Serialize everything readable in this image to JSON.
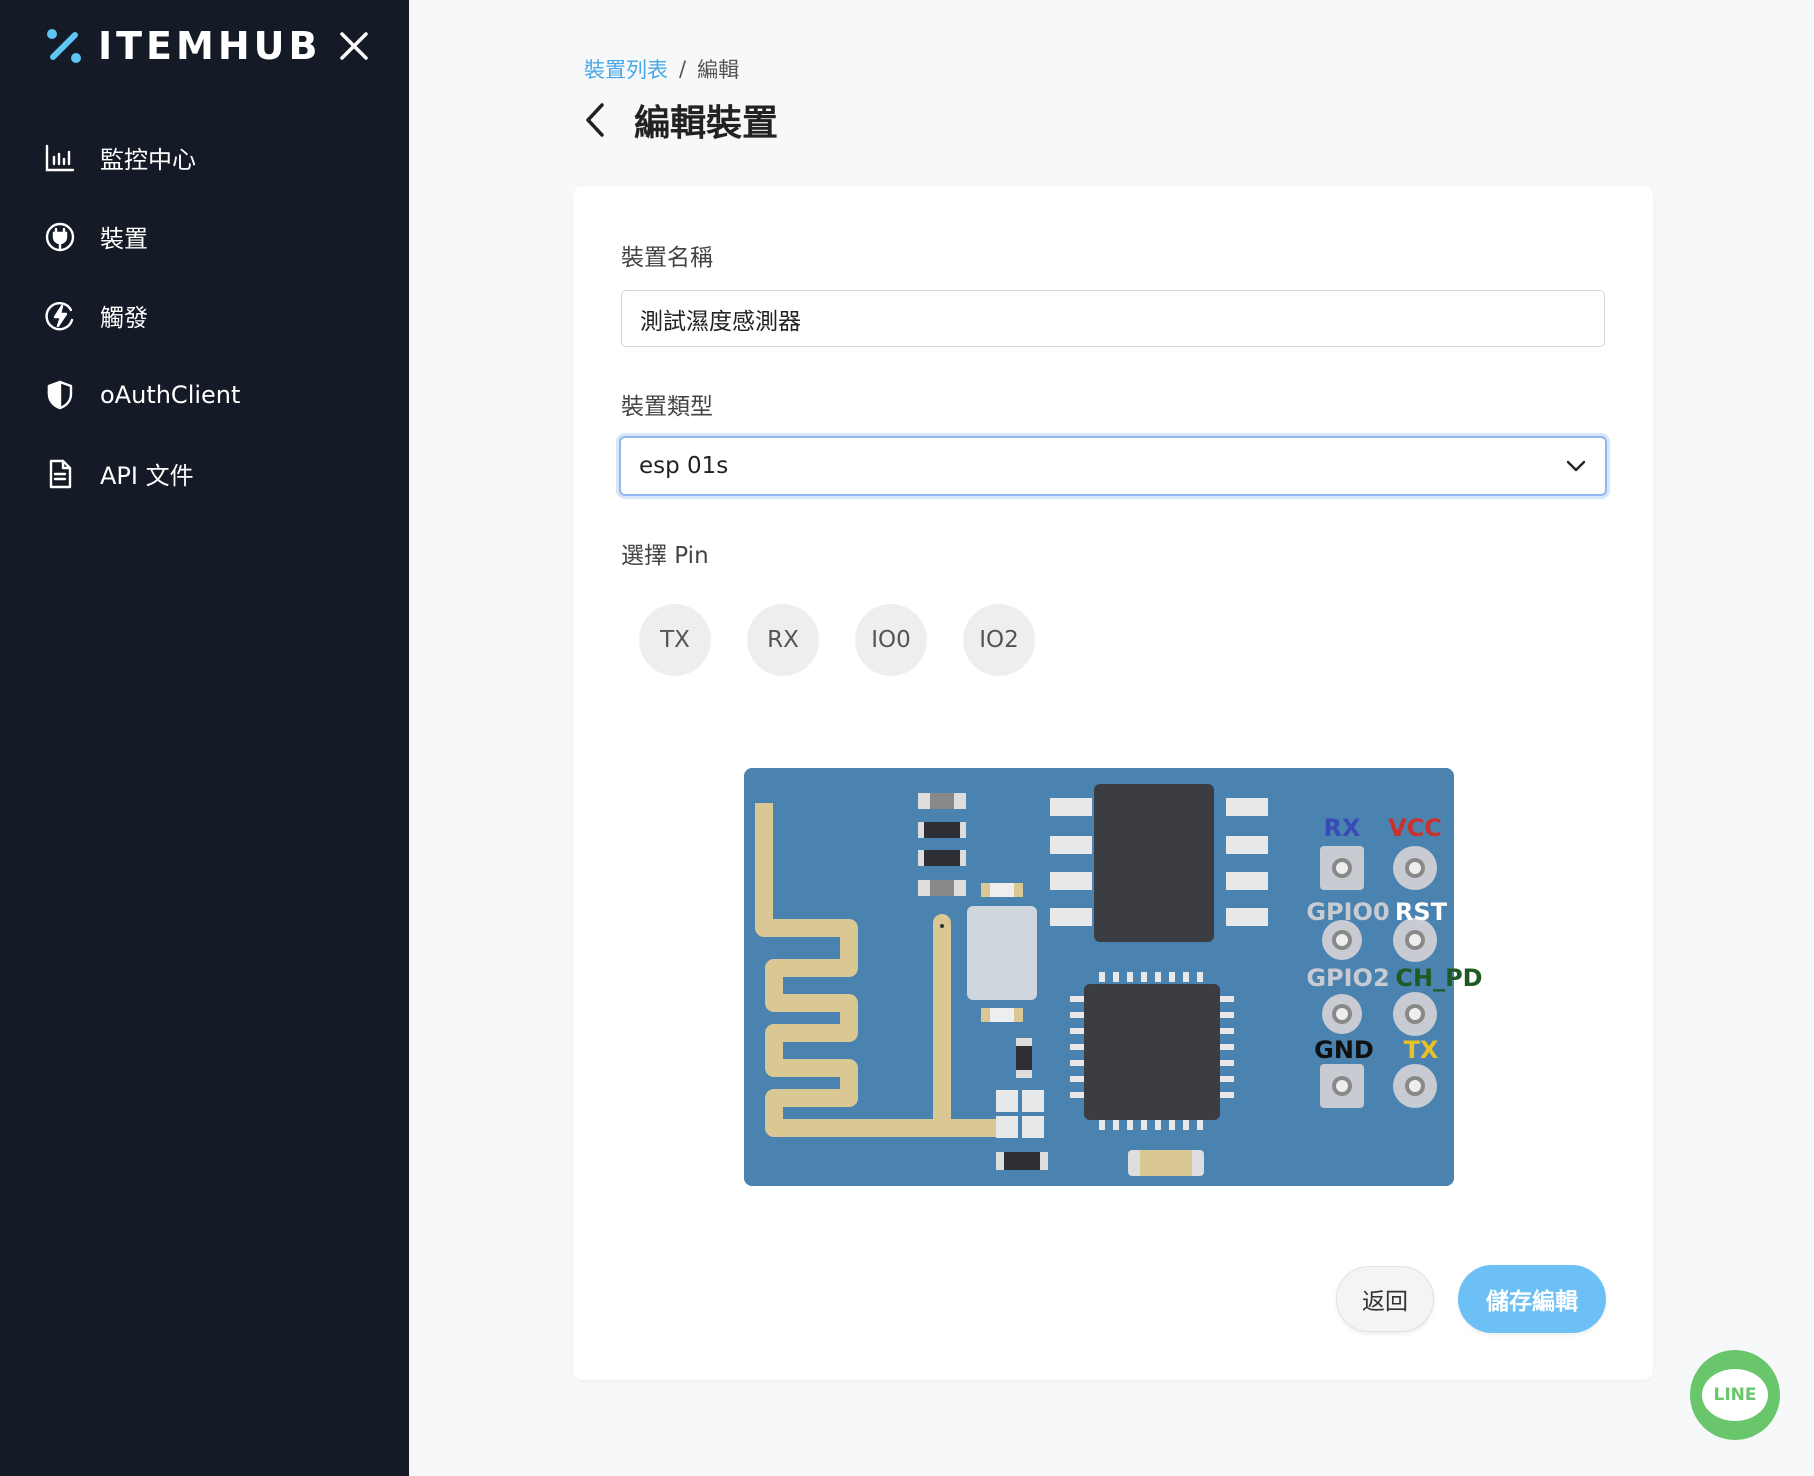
{
  "brand": {
    "name": "ITEMHUB"
  },
  "sidebar": {
    "items": [
      {
        "label": "監控中心",
        "icon": "chart-bar-icon"
      },
      {
        "label": "裝置",
        "icon": "plug-icon"
      },
      {
        "label": "觸發",
        "icon": "lightning-icon"
      },
      {
        "label": "oAuthClient",
        "icon": "shield-icon"
      },
      {
        "label": "API 文件",
        "icon": "document-icon"
      }
    ]
  },
  "breadcrumb": {
    "parent": "裝置列表",
    "separator": "/",
    "current": "編輯"
  },
  "page": {
    "title": "編輯裝置"
  },
  "form": {
    "name_label": "裝置名稱",
    "name_value": "測試濕度感測器",
    "type_label": "裝置類型",
    "type_value": "esp 01s",
    "pin_label": "選擇 Pin",
    "pins": [
      "TX",
      "RX",
      "IO0",
      "IO2"
    ]
  },
  "board": {
    "pin_labels": {
      "rx": "RX",
      "vcc": "VCC",
      "gpio0": "GPIO0",
      "rst": "RST",
      "gpio2": "GPIO2",
      "ch_pd": "CH_PD",
      "gnd": "GND",
      "tx": "TX"
    },
    "colors": {
      "pcb": "#4a82b0",
      "antenna": "#d9c894",
      "chip": "#3b3d42"
    }
  },
  "actions": {
    "back_label": "返回",
    "save_label": "儲存編輯"
  },
  "line": {
    "label": "LINE"
  },
  "colors": {
    "sidebar_bg": "#141a26",
    "accent": "#4aa8e8",
    "save_button": "#6cc0f5",
    "line_green": "#6ac66b"
  }
}
